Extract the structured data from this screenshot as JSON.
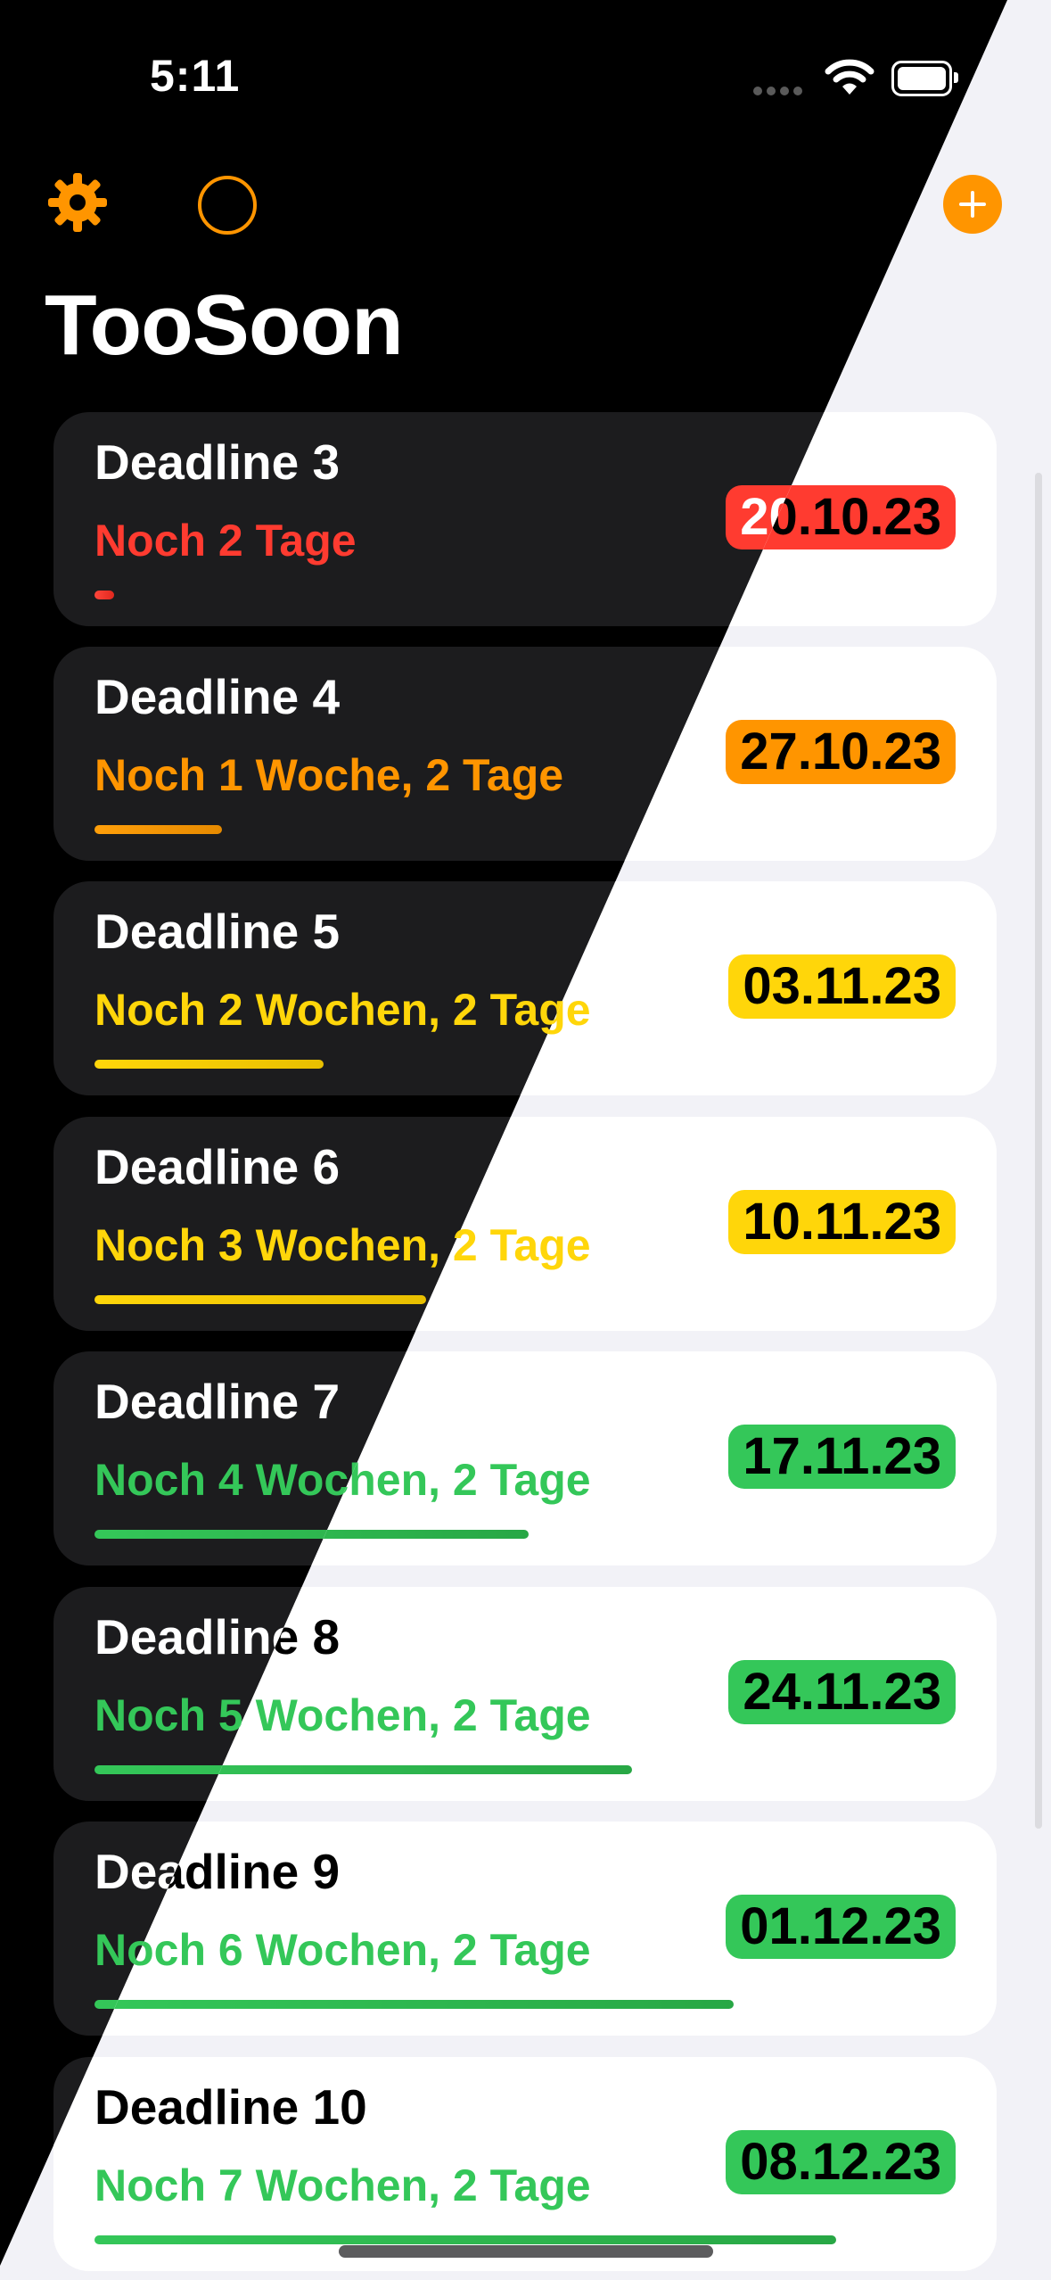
{
  "status_bar": {
    "time": "5:11"
  },
  "header": {
    "title": "TooSoon"
  },
  "colors": {
    "accent": "#ff9500",
    "red": "#ff3b30",
    "orange": "#ff9500",
    "yellow": "#ffd60a",
    "green": "#34c759"
  },
  "icons": [
    "gear-icon",
    "circle-icon",
    "plus-icon",
    "wifi-icon",
    "battery-icon"
  ],
  "deadlines": [
    {
      "title": "Deadline 3",
      "remaining": "Noch 2 Tage",
      "date": "20.10.23",
      "status": "red",
      "progress": 0.023
    },
    {
      "title": "Deadline 4",
      "remaining": "Noch 1 Woche, 2 Tage",
      "date": "27.10.23",
      "status": "orange",
      "progress": 0.148
    },
    {
      "title": "Deadline 5",
      "remaining": "Noch 2 Wochen, 2 Tage",
      "date": "03.11.23",
      "status": "yellow",
      "progress": 0.266
    },
    {
      "title": "Deadline 6",
      "remaining": "Noch 3 Wochen, 2 Tage",
      "date": "10.11.23",
      "status": "yellow",
      "progress": 0.385
    },
    {
      "title": "Deadline 7",
      "remaining": "Noch 4 Wochen, 2 Tage",
      "date": "17.11.23",
      "status": "green",
      "progress": 0.504
    },
    {
      "title": "Deadline 8",
      "remaining": "Noch 5 Wochen, 2 Tage",
      "date": "24.11.23",
      "status": "green",
      "progress": 0.624
    },
    {
      "title": "Deadline 9",
      "remaining": "Noch 6 Wochen, 2 Tage",
      "date": "01.12.23",
      "status": "green",
      "progress": 0.742
    },
    {
      "title": "Deadline 10",
      "remaining": "Noch 7 Wochen, 2 Tage",
      "date": "08.12.23",
      "status": "green",
      "progress": 0.861
    }
  ]
}
